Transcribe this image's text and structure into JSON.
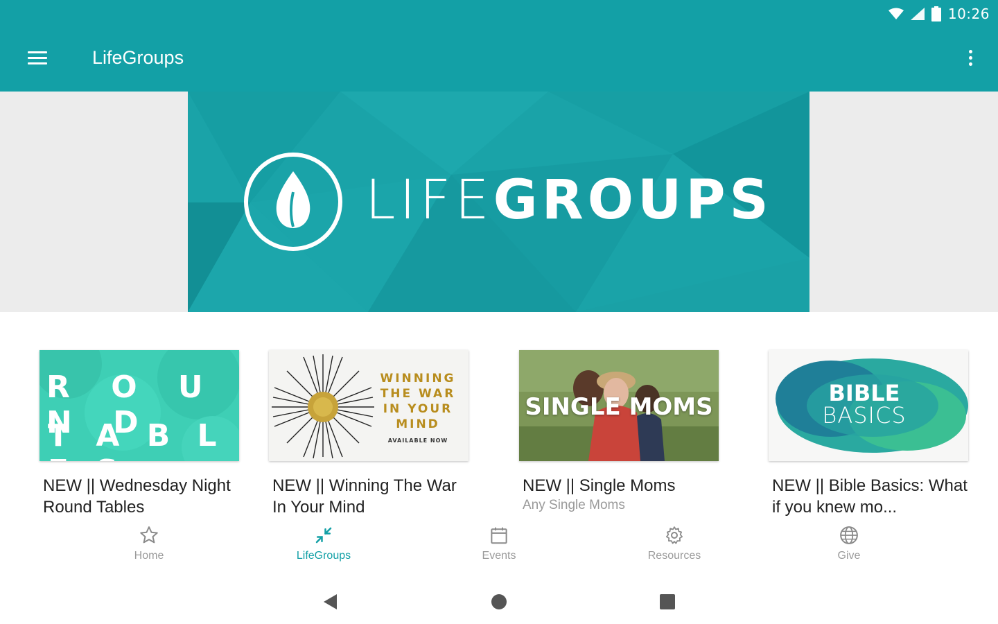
{
  "status_bar": {
    "time": "10:26"
  },
  "app_bar": {
    "title": "LifeGroups"
  },
  "banner": {
    "title_light": "LIFE",
    "title_bold": "GROUPS"
  },
  "cards": [
    {
      "thumb": {
        "line1": "R O U N D",
        "line2": "T A B L E S"
      },
      "title": "NEW || Wednesday Night Round Tables",
      "subtitle": ""
    },
    {
      "thumb": {
        "line1": "WINNING",
        "line2": "THE WAR",
        "line3": "IN YOUR",
        "line4": "MIND",
        "line5": "AVAILABLE NOW"
      },
      "title": "NEW || Winning The War In Your Mind",
      "subtitle": ""
    },
    {
      "thumb": {
        "line1": "SINGLE MOMS"
      },
      "title": "NEW || Single Moms",
      "subtitle": "Any Single Moms"
    },
    {
      "thumb": {
        "line1": "BIBLE",
        "line2": "BASICS"
      },
      "title": "NEW || Bible Basics: What if you knew mo...",
      "subtitle": ""
    }
  ],
  "bottom_nav": {
    "items": [
      {
        "label": "Home",
        "icon": "star-icon"
      },
      {
        "label": "LifeGroups",
        "icon": "collapse-arrows-icon",
        "active": true
      },
      {
        "label": "Events",
        "icon": "calendar-icon"
      },
      {
        "label": "Resources",
        "icon": "gear-icon"
      },
      {
        "label": "Give",
        "icon": "globe-icon"
      }
    ]
  },
  "colors": {
    "brand": "#13a0a6",
    "inactive": "#9a9a9a"
  }
}
